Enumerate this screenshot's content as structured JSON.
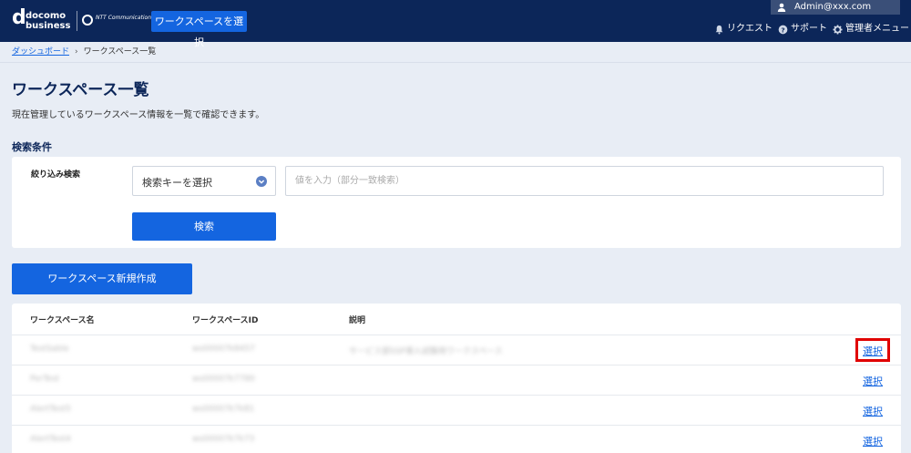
{
  "header": {
    "logo": {
      "mark": "d",
      "line1": "docomo",
      "line2": "business",
      "partner": "NTT Communications"
    },
    "workspace_button": "ワークスペースを選択",
    "user": "Admin@xxx.com",
    "links": [
      {
        "label": "リクエスト",
        "icon": "bell-icon"
      },
      {
        "label": "サポート",
        "icon": "help-icon"
      },
      {
        "label": "管理者メニュー",
        "icon": "gear-icon"
      }
    ]
  },
  "breadcrumb": {
    "home": "ダッシュボード",
    "separator": "›",
    "current": "ワークスペース一覧"
  },
  "page": {
    "title": "ワークスペース一覧",
    "description": "現在管理しているワークスペース情報を一覧で確認できます。"
  },
  "search": {
    "section_title": "検索条件",
    "filter_label": "絞り込み検索",
    "select_value": "検索キーを選択",
    "input_placeholder": "値を入力（部分一致検索）",
    "button": "検索"
  },
  "create_button": "ワークスペース新規作成",
  "table": {
    "columns": [
      "ワークスペース名",
      "ワークスペースID",
      "説明"
    ],
    "rows": [
      {
        "name": "TestSable",
        "id": "ws00007k8457",
        "desc": "サービス部SSP導入試験用ワークスペース",
        "action": "選択",
        "highlighted": true
      },
      {
        "name": "PerTest",
        "id": "ws00007k7780",
        "desc": "",
        "action": "選択",
        "highlighted": false
      },
      {
        "name": "AlertTest5",
        "id": "ws00007k7k81",
        "desc": "",
        "action": "選択",
        "highlighted": false
      },
      {
        "name": "AlertTest4",
        "id": "ws00007k7k73",
        "desc": "",
        "action": "選択",
        "highlighted": false
      }
    ]
  },
  "colors": {
    "header_bg": "#0c2659",
    "primary": "#1465e0",
    "page_bg": "#e8edf5",
    "highlight": "#e00000"
  }
}
